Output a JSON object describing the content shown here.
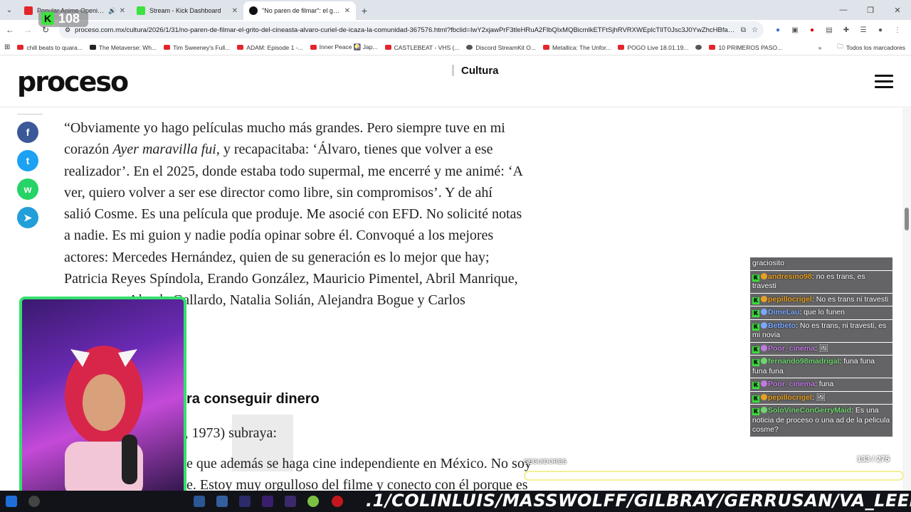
{
  "browser": {
    "tabs": [
      {
        "title": "Popular Anime Openings B",
        "favicon_color": "#e4252b",
        "audio": true
      },
      {
        "title": "Stream - Kick Dashboard",
        "favicon_color": "#3be33b",
        "audio": false
      },
      {
        "title": "\"No paren de filmar\": el grito d",
        "favicon_color": "#111111",
        "audio": false
      }
    ],
    "new_tab": "+",
    "url": "proceso.com.mx/cultura/2026/1/31/no-paren-de-filmar-el-grito-del-cineasta-alvaro-curiel-de-icaza-la-comunidad-367576.html?fbclid=IwY2xjawPrF3tleHRuA2FlbQIxMQBicmlkETFtSjhRVRXWEplcTlIT0Jsc3J0YwZhcHBfaW...",
    "bookmarks": [
      "chill beats to quara...",
      "The Metaverse: Wh...",
      "Tim Sweeney's Full...",
      "ADAM: Episode 1 -...",
      "Inner Peace 🎑 Jap...",
      "CASTLEBEAT - VHS (...",
      "Discord StreamKit O...",
      "Metallica: The Unfor...",
      "POGO Live 18.01.19...",
      "10 PRIMEROS PASO..."
    ],
    "bookmarks_more": "»",
    "all_bookmarks": "Todos los marcadores"
  },
  "site": {
    "logo": "proceso",
    "section": "Cultura"
  },
  "share": [
    "f",
    "t",
    "w",
    "➤"
  ],
  "article": {
    "lines": [
      "“Obviamente yo hago películas mucho más grandes. Pero siempre tuve en mi",
      "corazón ",
      "Ayer maravilla fui",
      ", y recapacitaba: ‘Álvaro, tienes que volver a ese",
      "realizador’. En el 2025, donde estaba todo supermal, me encerré y me animé: ‘A",
      "ver, quiero volver a ser ese director como libre, sin compromisos’. Y de ahí",
      "salió Cosme. Es una película que produje. Me asocié con EFD. No solicité notas",
      "a nadie. Es mi guion y nadie podía opinar sobre él. Convoqué a los mejores",
      "actores: Mercedes Hernández, quien de su generación es lo mejor que hay;",
      "Patricia Reyes Spíndola, Erando González, Mauricio Pimentel, Abril Manrique,",
      "Aleyda Gallardo, Natalia Solián, Alejandra Bogue y Carlos"
    ],
    "subhead": "ra conseguir dinero",
    "frag1": "F, 1973) subraya:",
    "frag2": "e que además se haga cine independiente en México. No soy",
    "frag3": "e. Estoy muy orgulloso del filme y conecto con él porque es"
  },
  "chat": {
    "messages": [
      {
        "user": "",
        "color": "#ffffff",
        "text": "graciosito"
      },
      {
        "user": "andresino98",
        "color": "#e8a020",
        "text": ": no es trans, es travesti"
      },
      {
        "user": "pepillocrigel",
        "color": "#e8a020",
        "text": ": No es trans ni travesti"
      },
      {
        "user": "DimeLau",
        "color": "#7aa8ff",
        "text": ": que lo funen"
      },
      {
        "user": "Betbeto",
        "color": "#7aa8ff",
        "text": ": No es trans, ni travesti, es mi novia"
      },
      {
        "user": "Poor_cinema",
        "color": "#c07ae0",
        "text": ": 🖼"
      },
      {
        "user": "fernando98madrigal",
        "color": "#6fd66f",
        "text": ": funa funa funa funa"
      },
      {
        "user": "Poor_cinema",
        "color": "#c07ae0",
        "text": ": funa"
      },
      {
        "user": "pepillocrigel",
        "color": "#e8a020",
        "text": ": 🖼"
      },
      {
        "user": "SoloVineConGerryMaid",
        "color": "#6fd66f",
        "text": ": Es una noticia de proceso o una ad de la pelicula cosme?"
      }
    ]
  },
  "viewers": {
    "count": "108"
  },
  "goal": {
    "label": "SEGUIDORES",
    "current": 133,
    "target": 275,
    "fraction": 0.484,
    "display": "133   / 275"
  },
  "ticker": ".1/COLINLUIS/MASSWOLFF/GILBRAY/GERRUSAN/VA_LEEE/ALEXHQ / IXCA CIENFUEGOS/ HIPOLI",
  "colors": {
    "kick_green": "#3be33b",
    "facebook": "#3b5998",
    "twitter": "#1da1f2",
    "whatsapp": "#25d366",
    "telegram": "#229ed9"
  }
}
